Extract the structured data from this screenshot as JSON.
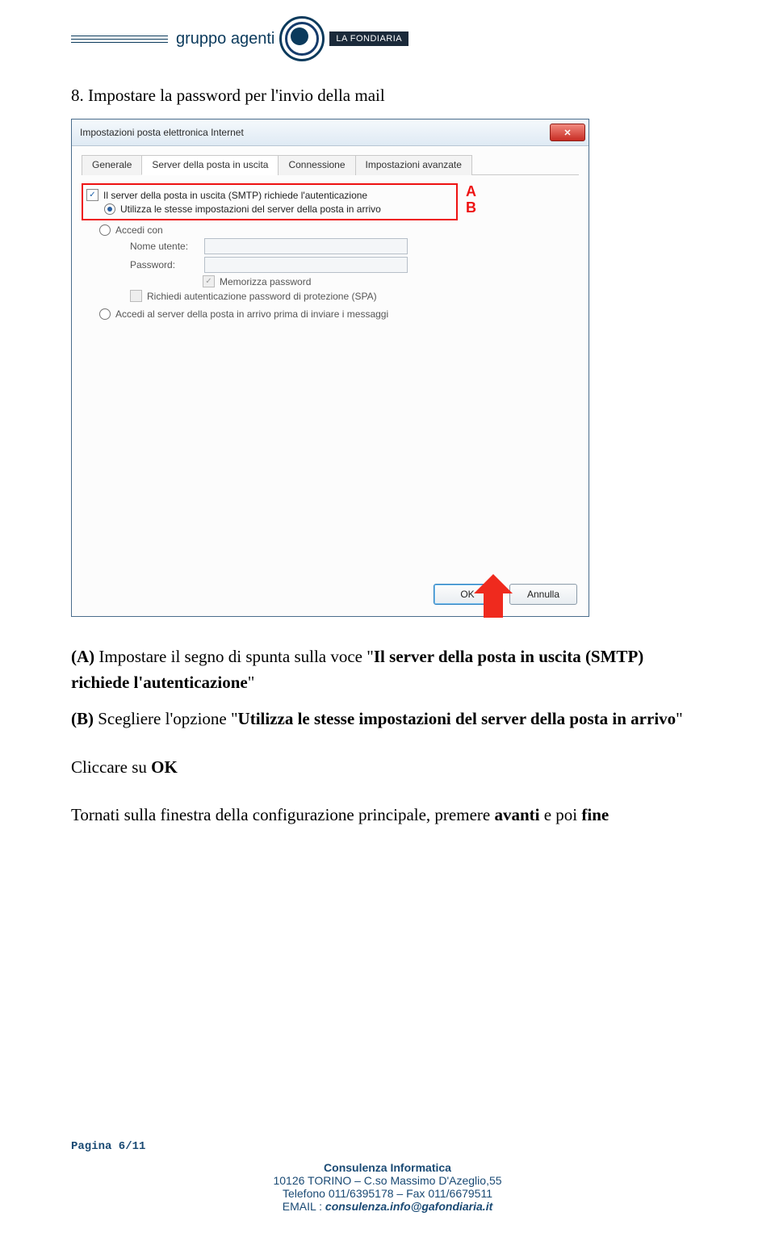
{
  "header": {
    "brand_text": "gruppo agenti",
    "brand_tag": "LA FONDIARIA"
  },
  "section_title": "8. Impostare la password per l'invio della mail",
  "dialog": {
    "title": "Impostazioni posta elettronica Internet",
    "tabs": [
      "Generale",
      "Server della posta in uscita",
      "Connessione",
      "Impostazioni avanzate"
    ],
    "active_tab_index": 1,
    "chk_smtp_auth": "Il server della posta in uscita (SMTP) richiede l'autenticazione",
    "radio_same_settings": "Utilizza le stesse impostazioni del server della posta in arrivo",
    "radio_login_with": "Accedi con",
    "label_username": "Nome utente:",
    "label_password": "Password:",
    "chk_remember": "Memorizza password",
    "chk_spa": "Richiedi autenticazione password di protezione (SPA)",
    "radio_pop_before": "Accedi al server della posta in arrivo prima di inviare i messaggi",
    "btn_ok": "OK",
    "btn_cancel": "Annulla",
    "anno_a": "A",
    "anno_b": "B"
  },
  "body": {
    "line_a_prefix": "(A)",
    "line_a_text": " Impostare il segno di spunta sulla voce \"",
    "line_a_bold": "Il server della posta in uscita (SMTP) richiede l'autenticazione",
    "line_a_suffix": "\"",
    "line_b_prefix": "(B)",
    "line_b_text": " Scegliere l'opzione \"",
    "line_b_bold": "Utilizza le stesse impostazioni del server della posta in arrivo",
    "line_b_suffix": "\"",
    "click_prefix": "Cliccare su ",
    "click_bold": "OK",
    "return_text_1": "Tornati sulla finestra della configurazione principale, premere ",
    "return_bold_1": "avanti",
    "return_text_2": " e poi ",
    "return_bold_2": "fine"
  },
  "footer": {
    "page": "Pagina 6/11",
    "l1": "Consulenza Informatica",
    "l2": "10126 TORINO – C.so Massimo D'Azeglio,55",
    "l3": "Telefono 011/6395178 – Fax 011/6679511",
    "l4_prefix": "EMAIL : ",
    "l4_em": "consulenza.info@gafondiaria.it"
  }
}
